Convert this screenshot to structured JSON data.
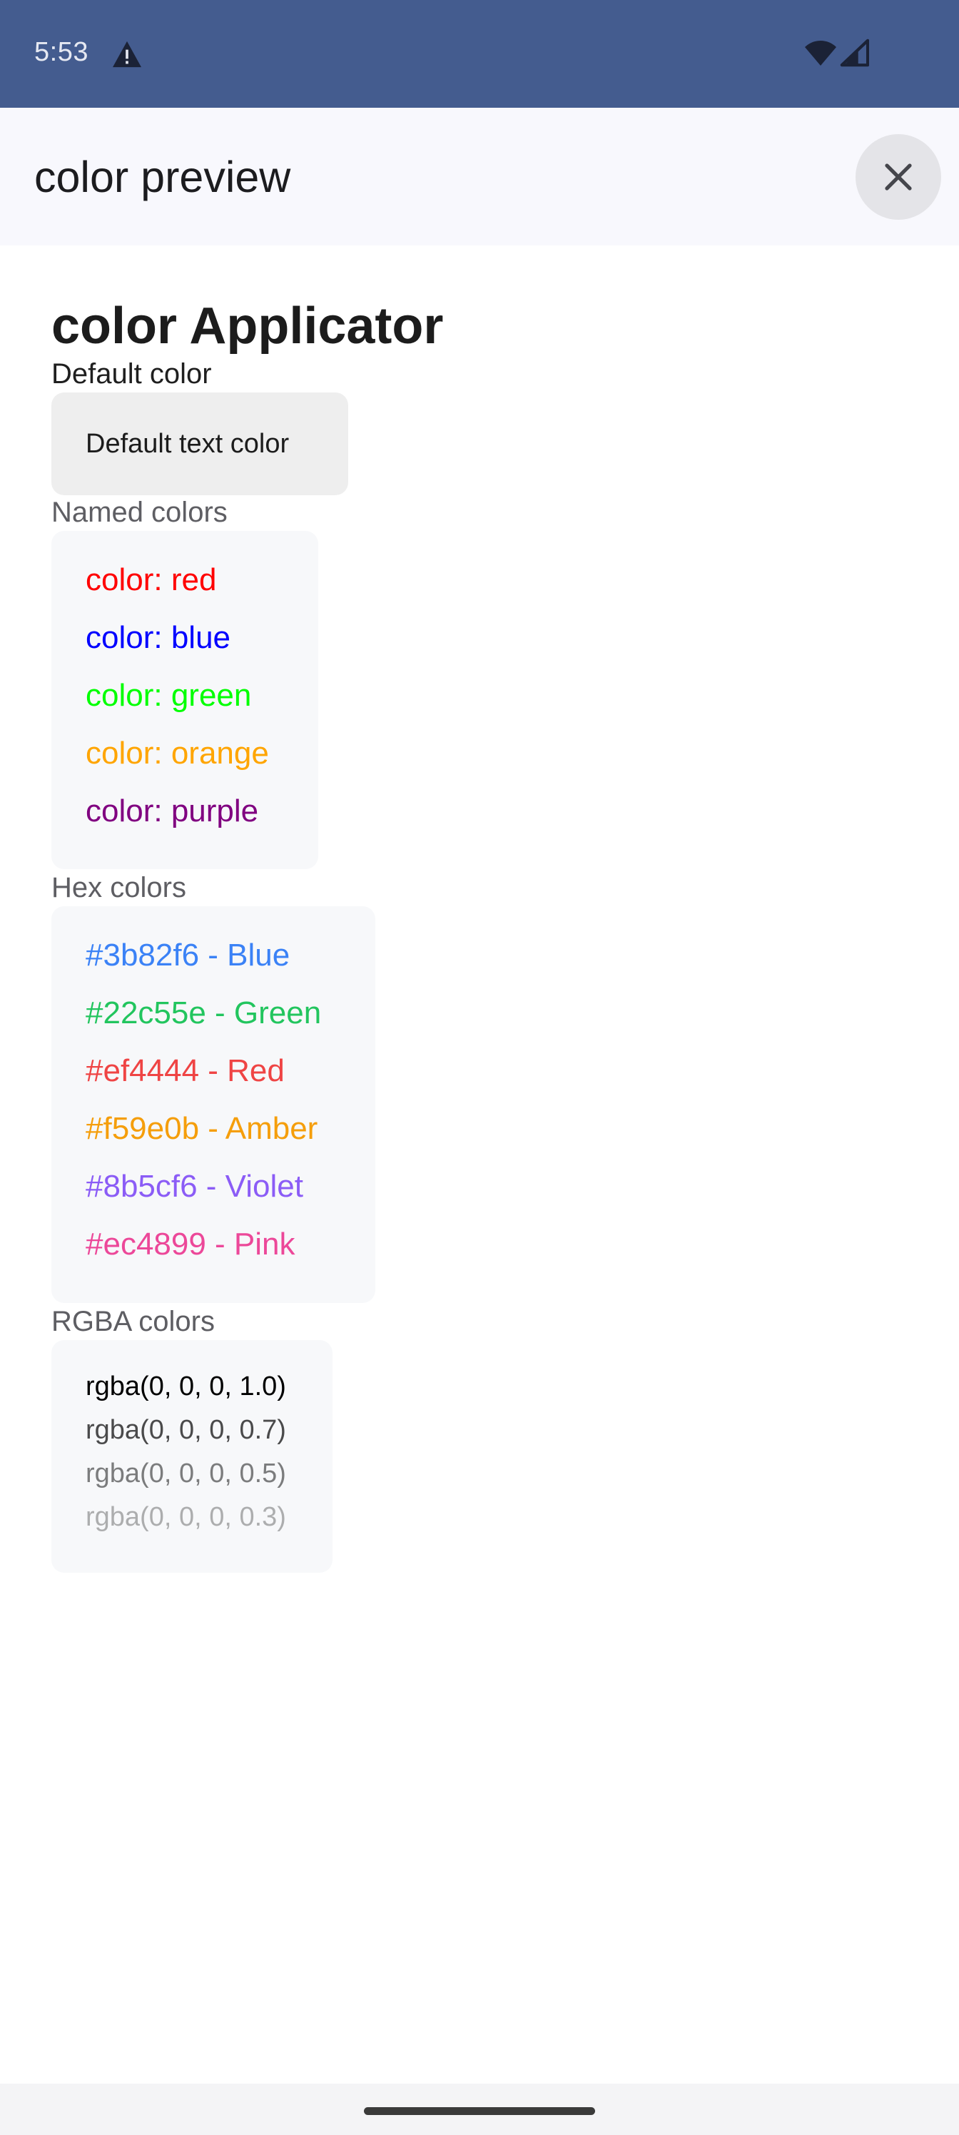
{
  "status_bar": {
    "time": "5:53"
  },
  "header": {
    "title": "color preview"
  },
  "page": {
    "title": "color Applicator",
    "default_section": {
      "label": "Default color",
      "text": "Default text color"
    },
    "named_section": {
      "label": "Named colors",
      "items": [
        {
          "text": "color: red",
          "color": "#ff0000"
        },
        {
          "text": "color: blue",
          "color": "#0000ff"
        },
        {
          "text": "color: green",
          "color": "#00ff00"
        },
        {
          "text": "color: orange",
          "color": "#ffa500"
        },
        {
          "text": "color: purple",
          "color": "#800080"
        }
      ]
    },
    "hex_section": {
      "label": "Hex colors",
      "items": [
        {
          "text": "#3b82f6 - Blue",
          "color": "#3b82f6"
        },
        {
          "text": "#22c55e - Green",
          "color": "#22c55e"
        },
        {
          "text": "#ef4444 - Red",
          "color": "#ef4444"
        },
        {
          "text": "#f59e0b - Amber",
          "color": "#f59e0b"
        },
        {
          "text": "#8b5cf6 - Violet",
          "color": "#8b5cf6"
        },
        {
          "text": "#ec4899 - Pink",
          "color": "#ec4899"
        }
      ]
    },
    "rgba_section": {
      "label": "RGBA colors",
      "items": [
        {
          "text": "rgba(0, 0, 0, 1.0)",
          "color": "rgba(0, 0, 0, 1.0)"
        },
        {
          "text": "rgba(0, 0, 0, 0.7)",
          "color": "rgba(0, 0, 0, 0.7)"
        },
        {
          "text": "rgba(0, 0, 0, 0.5)",
          "color": "rgba(0, 0, 0, 0.5)"
        },
        {
          "text": "rgba(0, 0, 0, 0.3)",
          "color": "rgba(0, 0, 0, 0.3)"
        }
      ]
    }
  },
  "icons": {
    "status": [
      "warning-icon",
      "wifi-icon",
      "cell-signal-icon"
    ],
    "header": [
      "close-icon"
    ]
  },
  "colors": {
    "status_bar_bg": "#445c8f",
    "header_bg": "#f8f8fd",
    "close_button_bg": "#e4e4e8",
    "card_bg": "#f7f8fa",
    "default_box_bg": "#eeeeee"
  }
}
